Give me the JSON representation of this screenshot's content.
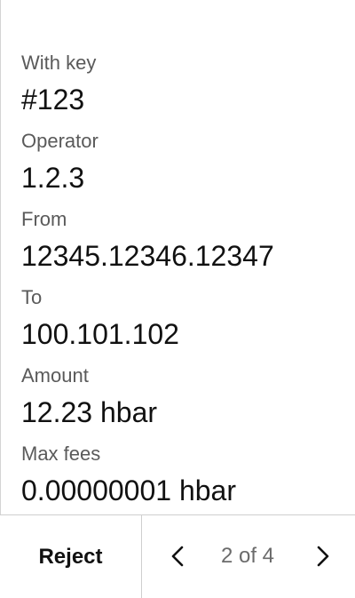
{
  "transaction": {
    "fields": [
      {
        "label": "With key",
        "value": "#123"
      },
      {
        "label": "Operator",
        "value": "1.2.3"
      },
      {
        "label": "From",
        "value": "12345.12346.12347"
      },
      {
        "label": "To",
        "value": "100.101.102"
      },
      {
        "label": "Amount",
        "value": "12.23 hbar"
      },
      {
        "label": "Max fees",
        "value": "0.00000001 hbar"
      }
    ]
  },
  "footer": {
    "reject_label": "Reject",
    "pager": {
      "current": 2,
      "total": 4,
      "text": "2 of 4"
    }
  },
  "icons": {
    "prev": "chevron-left-icon",
    "next": "chevron-right-icon"
  }
}
